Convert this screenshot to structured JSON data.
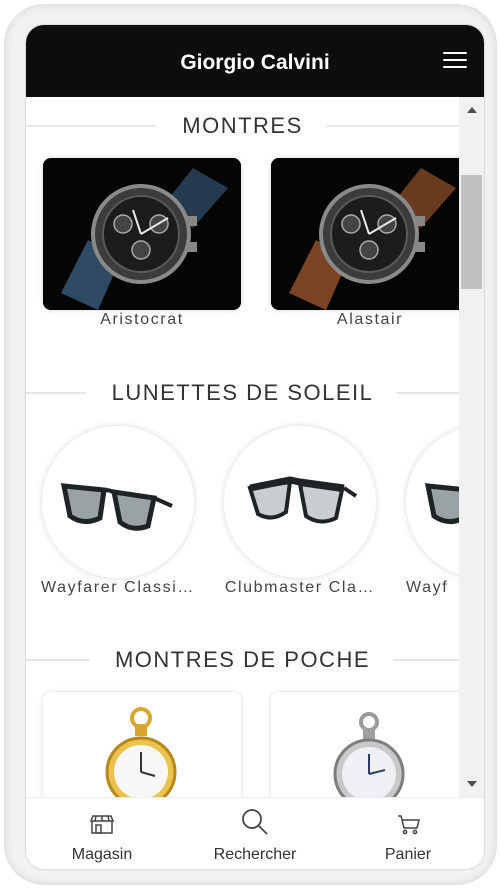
{
  "header": {
    "title": "Giorgio Calvini",
    "menu_icon": "hamburger-menu-icon"
  },
  "sections": [
    {
      "title": "MONTRES",
      "items": [
        {
          "label": "Aristocrat"
        },
        {
          "label": "Alastair"
        }
      ]
    },
    {
      "title": "LUNETTES DE SOLEIL",
      "items": [
        {
          "label": "Wayfarer Classi…"
        },
        {
          "label": "Clubmaster Cla…"
        },
        {
          "label": "Wayf"
        }
      ]
    },
    {
      "title": "MONTRES DE POCHE",
      "items": [
        {
          "label": ""
        },
        {
          "label": ""
        }
      ]
    }
  ],
  "tabs": [
    {
      "label": "Magasin",
      "icon": "store-icon"
    },
    {
      "label": "Rechercher",
      "icon": "search-icon"
    },
    {
      "label": "Panier",
      "icon": "cart-icon"
    }
  ],
  "colors": {
    "header_bg": "#0d0d0d",
    "strap_blue": "#2f4a63",
    "strap_brown": "#7a4424",
    "gold": "#d8a62a"
  }
}
